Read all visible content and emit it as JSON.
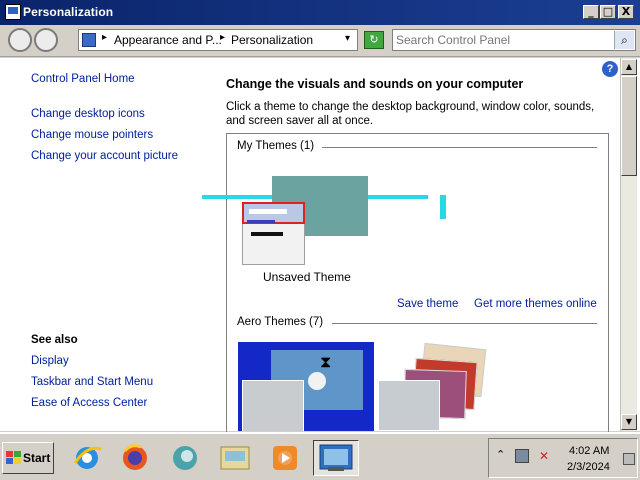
{
  "window": {
    "title": "Personalization",
    "buttons": {
      "minimize": "_",
      "maximize": "□",
      "close": "X"
    }
  },
  "address_bar": {
    "crumbs": [
      "Appearance and P...",
      "Personalization"
    ],
    "separator": "▸",
    "dropdown": "▾"
  },
  "search": {
    "placeholder": "Search Control Panel",
    "button_icon": "search-icon"
  },
  "sidebar": {
    "home": "Control Panel Home",
    "links": [
      "Change desktop icons",
      "Change mouse pointers",
      "Change your account picture"
    ],
    "see_also_title": "See also",
    "see_also": [
      "Display",
      "Taskbar and Start Menu",
      "Ease of Access Center"
    ]
  },
  "content": {
    "heading": "Change the visuals and sounds on your computer",
    "description": "Click a theme to change the desktop background, window color, sounds, and screen saver all at once.",
    "my_themes_title": "My Themes (1)",
    "unsaved_theme": "Unsaved Theme",
    "save_theme": "Save theme",
    "get_more_themes": "Get more themes online",
    "aero_themes_title": "Aero Themes (7)"
  },
  "taskbar": {
    "start_label": "Start",
    "icons": [
      "internet-explorer-icon",
      "firefox-icon",
      "edge-icon",
      "control-panel-icon",
      "media-player-icon",
      "personalization-icon"
    ],
    "time": "4:02 AM",
    "date": "2/3/2024"
  },
  "colors": {
    "title_bar": "#0a246a",
    "link": "#00219c",
    "taskbar": "#d4d0c8"
  }
}
